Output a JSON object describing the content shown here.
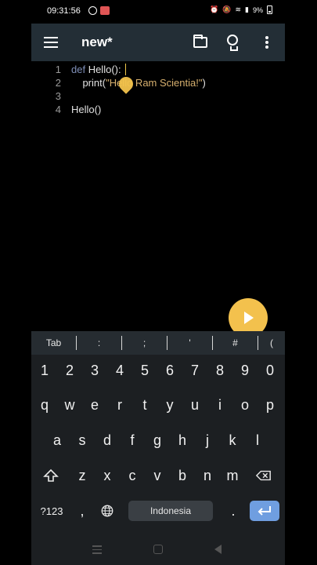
{
  "status": {
    "time": "09:31:56",
    "battery": "9%"
  },
  "appbar": {
    "title": "new*",
    "icons": [
      "menu-icon",
      "folder-icon",
      "lightbulb-icon",
      "more-vert-icon"
    ]
  },
  "editor": {
    "lines": [
      {
        "num": "1",
        "kw": "def",
        "rest": " Hello():"
      },
      {
        "num": "2",
        "pre": "    print(",
        "str": "\"Hello Ram Scientia!\"",
        "post": ")"
      },
      {
        "num": "3",
        "text": ""
      },
      {
        "num": "4",
        "text": "Hello()"
      }
    ]
  },
  "symbols": [
    "Tab",
    ":",
    ";",
    "'",
    "#",
    "("
  ],
  "keyboard": {
    "row1": [
      "1",
      "2",
      "3",
      "4",
      "5",
      "6",
      "7",
      "8",
      "9",
      "0"
    ],
    "row2": [
      "q",
      "w",
      "e",
      "r",
      "t",
      "y",
      "u",
      "i",
      "o",
      "p"
    ],
    "row3": [
      "a",
      "s",
      "d",
      "f",
      "g",
      "h",
      "j",
      "k",
      "l"
    ],
    "row4": [
      "z",
      "x",
      "c",
      "v",
      "b",
      "n",
      "m"
    ],
    "numkey": "?123",
    "comma": ",",
    "space": "Indonesia",
    "period": "."
  },
  "colors": {
    "appbar": "#232e36",
    "accent": "#f3c14d",
    "enter": "#6f9ee0"
  }
}
